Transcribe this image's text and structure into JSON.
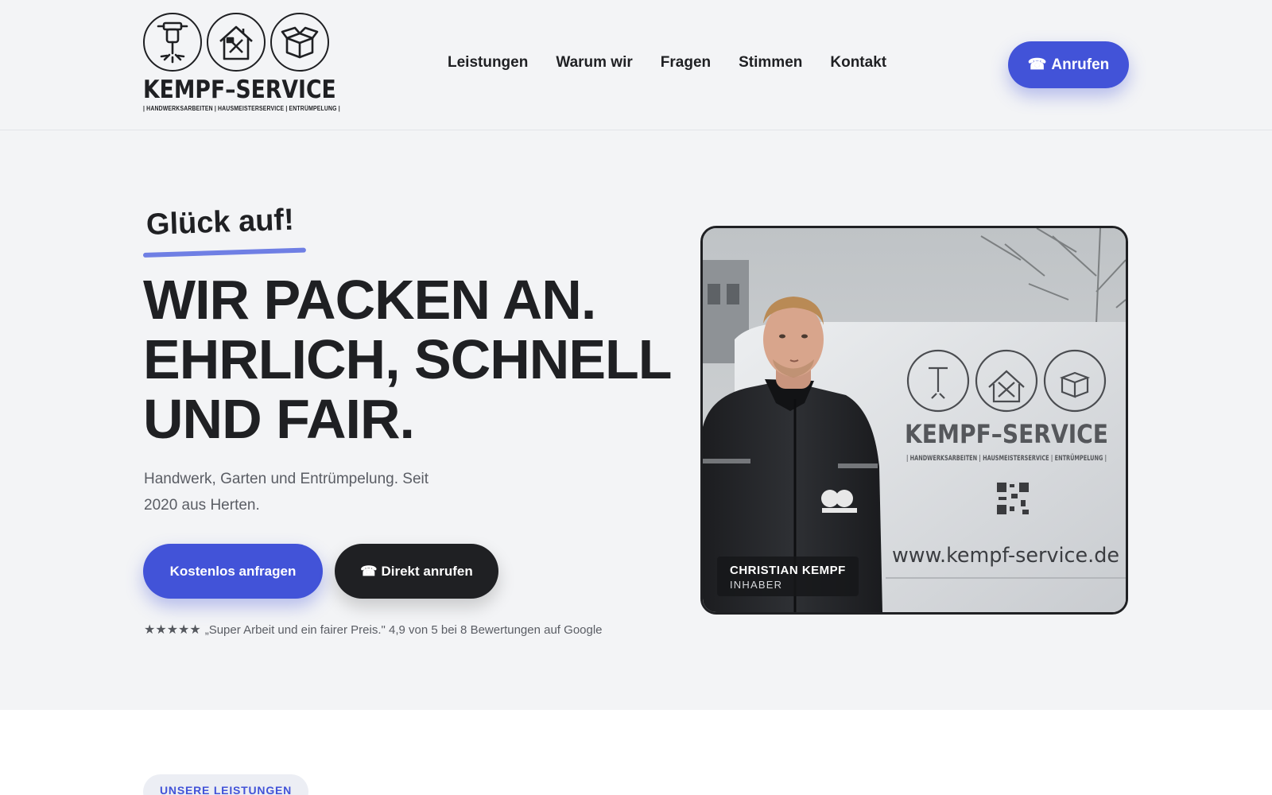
{
  "header": {
    "logo": {
      "wordmark": "KEMPF–SERVICE",
      "tagline": "| HANDWERKSARBEITEN | HAUSMEISTERSERVICE | ENTRÜMPELUNG |",
      "icons": [
        "jackhammer-icon",
        "house-tools-icon",
        "box-icon"
      ]
    },
    "nav": [
      {
        "label": "Leistungen"
      },
      {
        "label": "Warum wir"
      },
      {
        "label": "Fragen"
      },
      {
        "label": "Stimmen"
      },
      {
        "label": "Kontakt"
      }
    ],
    "call_button": {
      "icon": "phone-icon",
      "label": "Anrufen"
    }
  },
  "hero": {
    "greeting": "Glück auf!",
    "headline": [
      "WIR PACKEN AN.",
      "EHRLICH, SCHNELL",
      "UND FAIR."
    ],
    "subtext": "Handwerk, Garten und Entrümpelung. Seit 2020 aus Herten.",
    "primary_button": "Kostenlos anfragen",
    "secondary_button": {
      "icon": "phone-icon",
      "label": "Direkt anrufen"
    },
    "review": {
      "stars": "★★★★★",
      "text": "„Super Arbeit und ein fairer Preis.\" 4,9 von 5 bei 8 Bewertungen auf Google"
    },
    "photo": {
      "van_brand": "KEMPF–SERVICE",
      "van_tagline": "| HANDWERKSARBEITEN | HAUSMEISTERSERVICE | ENTRÜMPELUNG |",
      "van_url": "www.kempf-service.de",
      "caption_name": "CHRISTIAN KEMPF",
      "caption_role": "INHABER"
    }
  },
  "next_section": {
    "pill": "UNSERE LEISTUNGEN"
  },
  "colors": {
    "accent": "#4253d8",
    "dark": "#1f2023",
    "background": "#f3f4f6",
    "underline": "#6f7fe4"
  }
}
